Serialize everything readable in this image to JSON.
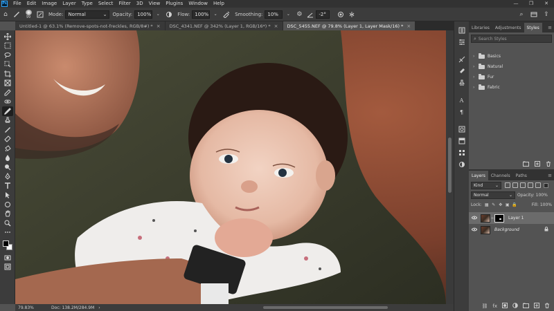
{
  "app": {
    "logo": "Ps"
  },
  "menu": [
    "File",
    "Edit",
    "Image",
    "Layer",
    "Type",
    "Select",
    "Filter",
    "3D",
    "View",
    "Plugins",
    "Window",
    "Help"
  ],
  "window_controls": {
    "minimize": "—",
    "maximize": "❐",
    "close": "✕"
  },
  "options": {
    "brush_size": "99",
    "mode_label": "Mode:",
    "mode_value": "Normal",
    "opacity_label": "Opacity:",
    "opacity_value": "100%",
    "flow_label": "Flow:",
    "flow_value": "100%",
    "smoothing_label": "Smoothing:",
    "smoothing_value": "10%",
    "angle_value": "-2°",
    "dropdown_caret": "⌄"
  },
  "tabs": [
    {
      "label": "Untitled-1 @ 63.1% (Remove-spots-not-freckles, RGB/8#) *",
      "close": "×"
    },
    {
      "label": "DSC_4341.NEF @ 342% (Layer 1, RGB/16*) *",
      "close": "×"
    },
    {
      "label": "DSC_5455.NEF @ 79.8% (Layer 1, Layer Mask/16) *",
      "close": "×"
    }
  ],
  "status": {
    "zoom": "79.83%",
    "doc": "Doc: 138.2M/284.9M",
    "arrow": "›"
  },
  "styles_panel": {
    "tabs": [
      "Libraries",
      "Adjustments",
      "Styles"
    ],
    "menu": "≡",
    "search_placeholder": "Search Styles",
    "folders": [
      "Basics",
      "Natural",
      "Fur",
      "Fabric"
    ]
  },
  "layers_panel": {
    "tabs": [
      "Layers",
      "Channels",
      "Paths"
    ],
    "menu": "≡",
    "kind_label": "Kind",
    "blend_mode": "Normal",
    "opacity_label": "Opacity:",
    "opacity_value": "100%",
    "lock_label": "Lock:",
    "fill_label": "Fill:",
    "fill_value": "100%",
    "layers": [
      {
        "name": "Layer 1"
      },
      {
        "name": "Background"
      }
    ]
  },
  "icons": {
    "home": "⌂",
    "brush": "🖌",
    "settings": "⚙",
    "search": "⌕",
    "share": "⇪",
    "lock": "🔒",
    "eye": "👁",
    "link": "⛓",
    "trash": "🗑",
    "folder": "▭",
    "add": "+",
    "chevron": "›",
    "fx": "fx"
  },
  "colors": {
    "accent": "#31a8ff",
    "panel": "#535353",
    "chrome": "#323232"
  }
}
